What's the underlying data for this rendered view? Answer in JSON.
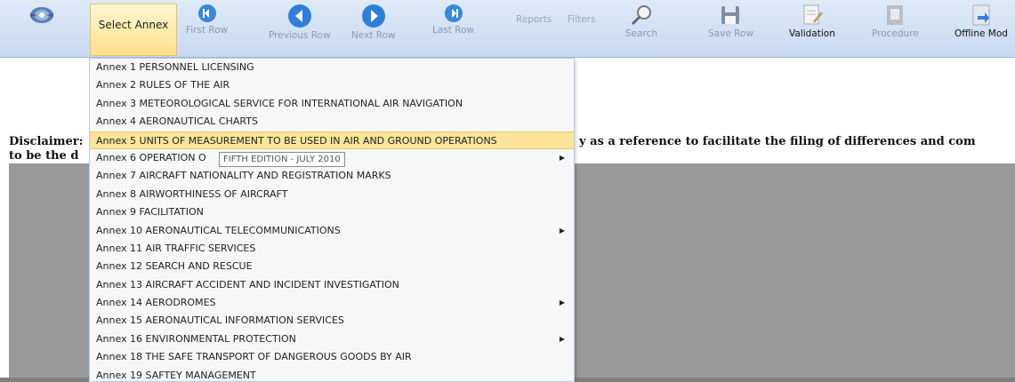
{
  "toolbar": {
    "select_annex": "Select Annex",
    "first_row": "First Row",
    "previous_row": "Previous Row",
    "next_row": "Next Row",
    "last_row": "Last Row",
    "reports": "Reports",
    "filters": "Filters",
    "search": "Search",
    "save_row": "Save Row",
    "validation": "Validation",
    "procedure": "Procedure",
    "offline_mode": "Offline Mod"
  },
  "disclaimer": {
    "label": "Disclaimer:",
    "line2_start": "to be the d",
    "right_text": "y as a reference to facilitate the filing of differences and com"
  },
  "menu": {
    "items": [
      {
        "label": "Annex 1 PERSONNEL LICENSING",
        "submenu": false
      },
      {
        "label": "Annex 2 RULES OF THE AIR",
        "submenu": false
      },
      {
        "label": "Annex 3 METEOROLOGICAL SERVICE FOR INTERNATIONAL AIR NAVIGATION",
        "submenu": false
      },
      {
        "label": "Annex 4 AERONAUTICAL CHARTS",
        "submenu": false
      },
      {
        "label": "Annex 5 UNITS OF MEASUREMENT TO BE USED IN AIR AND GROUND OPERATIONS",
        "submenu": false,
        "active": true
      },
      {
        "label": "Annex 6 OPERATION O",
        "submenu": true
      },
      {
        "label": "Annex 7 AIRCRAFT NATIONALITY AND REGISTRATION MARKS",
        "submenu": false
      },
      {
        "label": "Annex 8 AIRWORTHINESS OF AIRCRAFT",
        "submenu": false
      },
      {
        "label": "Annex 9 FACILITATION",
        "submenu": false
      },
      {
        "label": "Annex 10 AERONAUTICAL TELECOMMUNICATIONS",
        "submenu": true
      },
      {
        "label": "Annex 11 AIR TRAFFIC SERVICES",
        "submenu": false
      },
      {
        "label": "Annex 12 SEARCH AND RESCUE",
        "submenu": false
      },
      {
        "label": "Annex 13 AIRCRAFT ACCIDENT AND INCIDENT INVESTIGATION",
        "submenu": false
      },
      {
        "label": "Annex 14 AERODROMES",
        "submenu": true
      },
      {
        "label": "Annex 15 AERONAUTICAL INFORMATION SERVICES",
        "submenu": false
      },
      {
        "label": "Annex 16 ENVIRONMENTAL PROTECTION",
        "submenu": true
      },
      {
        "label": "Annex 18 THE SAFE TRANSPORT OF DANGEROUS GOODS BY AIR",
        "submenu": false
      },
      {
        "label": "Annex 19 SAFTEY MANAGEMENT",
        "submenu": false
      }
    ],
    "tooltip": "FIFTH EDITION - JULY 2010",
    "submenu_arrow": "▶"
  },
  "colors": {
    "toolbar_bg": "#c6d9f1",
    "nav_blue": "#2f7fd8",
    "highlight": "#fbe49a",
    "panel_gray": "#999999"
  }
}
